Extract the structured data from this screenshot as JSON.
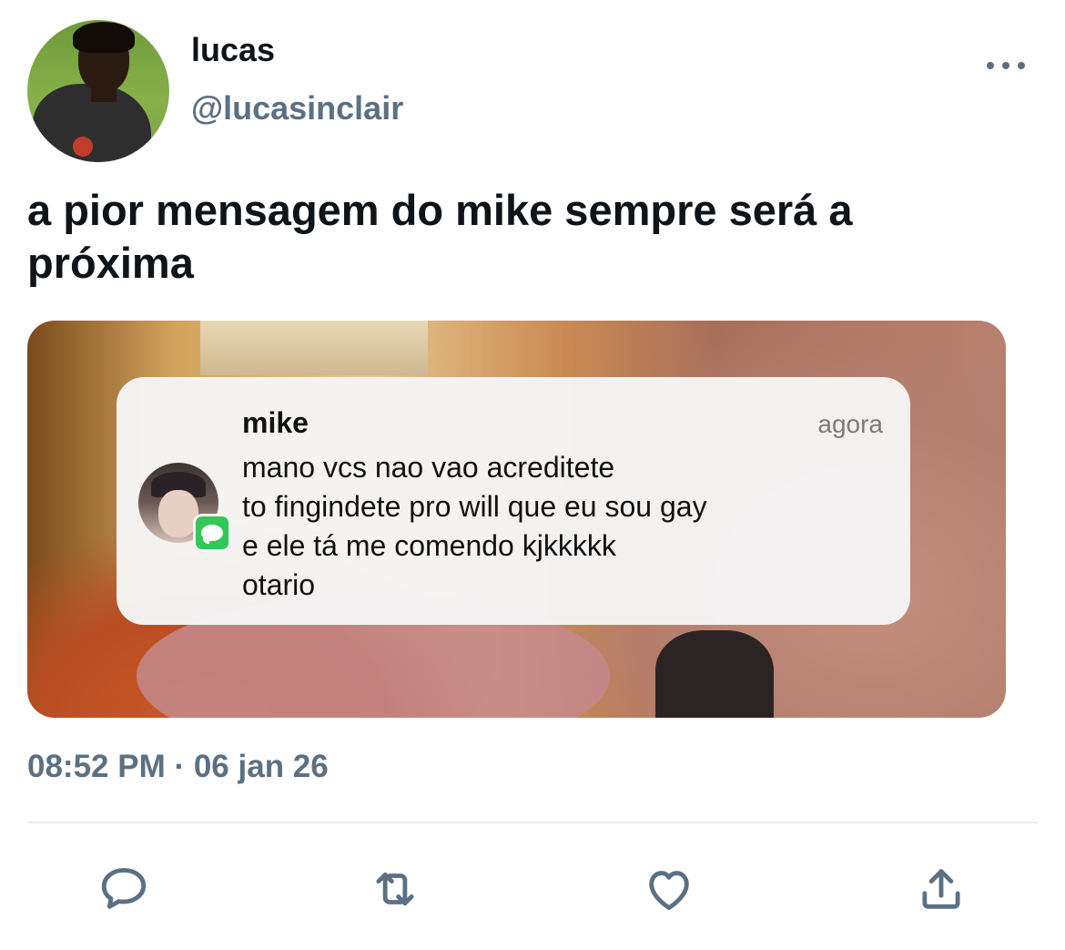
{
  "author": {
    "name": "lucas",
    "handle": "@lucasinclair",
    "avatar_icon": "profile-photo"
  },
  "tweet": {
    "text": "a pior mensagem do mike sempre será a próxima",
    "timestamp": "08:52 PM · 06 jan 26"
  },
  "notification": {
    "sender": "mike",
    "time": "agora",
    "lines": [
      "mano vcs nao vao acreditete",
      "to fingindete pro will que eu sou gay",
      "e ele tá me comendo kjkkkkk",
      "otario"
    ],
    "app_icon": "messages-icon",
    "app_color": "#34c759"
  },
  "actions": [
    {
      "name": "reply",
      "icon": "reply-icon"
    },
    {
      "name": "retweet",
      "icon": "retweet-icon"
    },
    {
      "name": "like",
      "icon": "heart-icon"
    },
    {
      "name": "share",
      "icon": "share-icon"
    }
  ],
  "colors": {
    "text_primary": "#0f1419",
    "text_secondary": "#5b7083",
    "divider": "#e6ecf0"
  }
}
